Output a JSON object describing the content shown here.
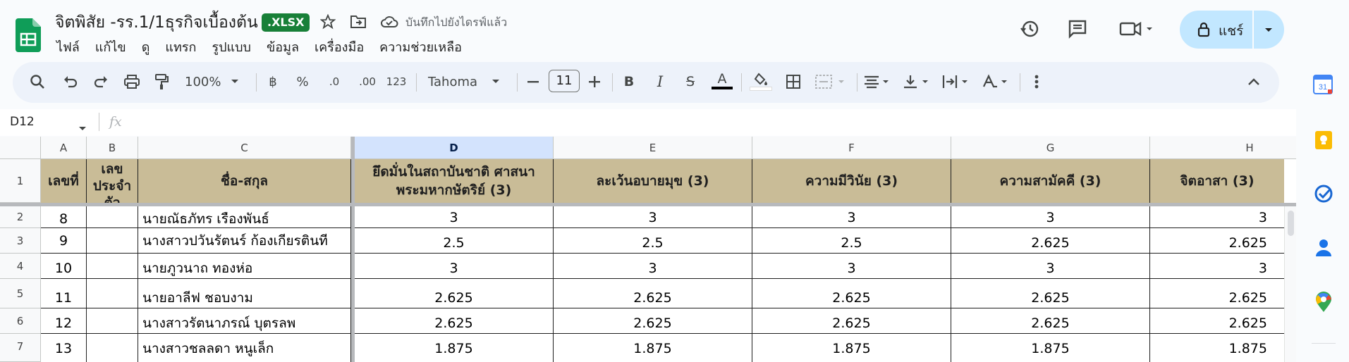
{
  "doc": {
    "title": "จิตพิสัย -รร.1/1ธุรกิจเบื้องต้น",
    "badge": ".XLSX",
    "save_status": "บันทึกไปยังไดรฟ์แล้ว",
    "star_icon": "star-icon",
    "folder_icon": "move-folder-icon",
    "cloud_icon": "cloud-saved-icon"
  },
  "menu": [
    "ไฟล์",
    "แก้ไข",
    "ดู",
    "แทรก",
    "รูปแบบ",
    "ข้อมูล",
    "เครื่องมือ",
    "ความช่วยเหลือ"
  ],
  "header_right": {
    "share_label": "แชร์"
  },
  "toolbar": {
    "zoom": "100%",
    "currency": "฿",
    "percent": "%",
    "dec_decrease": ".0",
    "dec_increase": ".00",
    "number_format": "123",
    "font": "Tahoma",
    "font_size": "11",
    "bold": "B",
    "italic": "I",
    "strike": "S",
    "text_color": "A"
  },
  "formula_bar": {
    "cell_ref": "D12",
    "fx": "fx"
  },
  "columns": [
    "A",
    "B",
    "C",
    "D",
    "E",
    "F",
    "G",
    "H"
  ],
  "selected_column": "D",
  "row_numbers": [
    "1",
    "2",
    "3",
    "4",
    "5",
    "6",
    "7"
  ],
  "headers": {
    "a": "เลขที่",
    "b": "เลขประจำตัว",
    "c": "ชื่อ-สกุล",
    "d": "ยึดมั่นในสถาบันชาติ ศาสนา พระมหากษัตริย์ (3)",
    "e": "ละเว้นอบายมุข (3)",
    "f": "ความมีวินัย (3)",
    "g": "ความสามัคคี (3)",
    "h": "จิตอาสา (3)"
  },
  "rows": [
    {
      "no": "8",
      "id": "",
      "name": "นายณัธภัทร  เรืองพันธ์",
      "d": "3",
      "e": "3",
      "f": "3",
      "g": "3",
      "h": "3"
    },
    {
      "no": "9",
      "id": "",
      "name": "นางสาวปวันรัตนร์   ก้องเกียรตินที",
      "d": "2.5",
      "e": "2.5",
      "f": "2.5",
      "g": "2.625",
      "h": "2.625"
    },
    {
      "no": "10",
      "id": "",
      "name": "นายภูวนาถ ทองห่อ",
      "d": "3",
      "e": "3",
      "f": "3",
      "g": "3",
      "h": "3"
    },
    {
      "no": "11",
      "id": "",
      "name": "นายอาลีฟ ชอบงาม",
      "d": "2.625",
      "e": "2.625",
      "f": "2.625",
      "g": "2.625",
      "h": "2.625"
    },
    {
      "no": "12",
      "id": "",
      "name": "นางสาวรัตนาภรณ์  บุตรลพ",
      "d": "2.625",
      "e": "2.625",
      "f": "2.625",
      "g": "2.625",
      "h": "2.625"
    },
    {
      "no": "13",
      "id": "",
      "name": "นางสาวชลลดา  หนูเล็ก",
      "d": "1.875",
      "e": "1.875",
      "f": "1.875",
      "g": "1.875",
      "h": "1.875"
    }
  ],
  "side_panel": {
    "calendar_label": "31"
  },
  "colors": {
    "header_fill": "#c9bc97",
    "selected_col": "#d3e3fd",
    "share_bg": "#c2e7ff",
    "brand_green": "#188038"
  }
}
